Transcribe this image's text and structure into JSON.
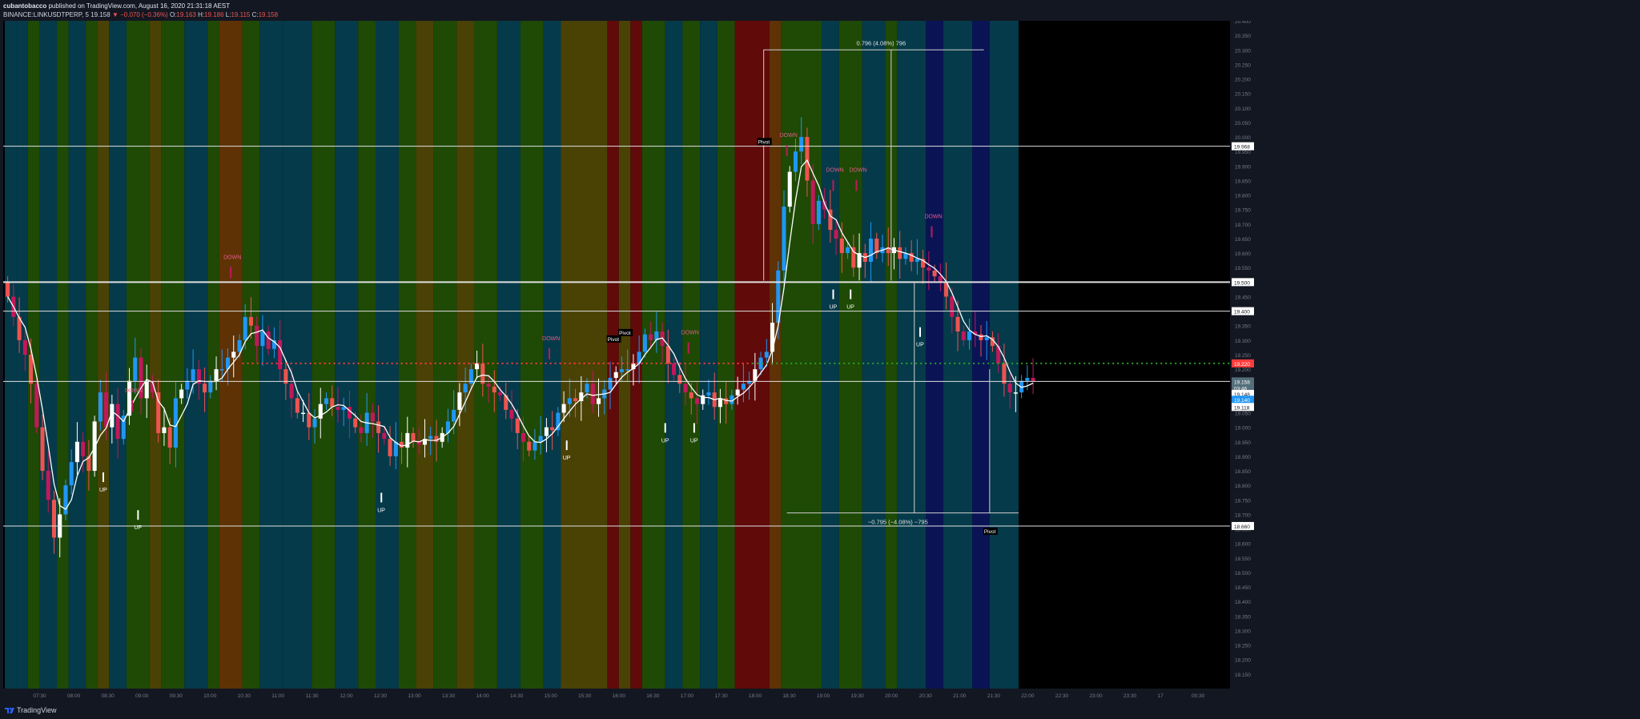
{
  "header": {
    "author": "cubantobacco",
    "published_text": "published on TradingView.com, August 16, 2020 21:31:18 AEST",
    "symbol": "BINANCE:LINKUSDTPERP, 5",
    "last": "19.158",
    "change": "−0.070 (−0.36%)",
    "o_label": "O:",
    "o": "19.163",
    "h_label": "H:",
    "h": "19.186",
    "l_label": "L:",
    "l": "19.115",
    "c_label": "C:",
    "c": "19.158"
  },
  "footer": {
    "brand": "TradingView"
  },
  "colors": {
    "bg": "#131722",
    "plot_bg": "#000000",
    "up_blue": "#2196f3",
    "up_white": "#ffffff",
    "down_red": "#ef5350",
    "down_magenta": "#c2185b",
    "band_blue": "#053a4a",
    "band_green": "#1e4a05",
    "band_olive": "#4a4205",
    "band_brown": "#5e3205",
    "band_red": "#600a0a",
    "band_navy": "#0a1455"
  },
  "chart_data": {
    "type": "candlestick",
    "symbol": "BINANCE:LINKUSDTPERP",
    "interval": "5",
    "ylim": [
      18.1,
      20.4
    ],
    "y_ticks": [
      "20.400",
      "20.350",
      "20.300",
      "20.250",
      "20.200",
      "20.150",
      "20.100",
      "20.050",
      "20.000",
      "19.950",
      "19.900",
      "19.850",
      "19.800",
      "19.750",
      "19.700",
      "19.650",
      "19.600",
      "19.550",
      "19.500",
      "19.450",
      "19.400",
      "19.350",
      "19.300",
      "19.250",
      "19.200",
      "19.150",
      "19.100",
      "19.050",
      "19.000",
      "18.950",
      "18.900",
      "18.850",
      "18.800",
      "18.750",
      "18.700",
      "18.650",
      "18.600",
      "18.550",
      "18.500",
      "18.450",
      "18.400",
      "18.350",
      "18.300",
      "18.250",
      "18.200",
      "18.150"
    ],
    "x_ticks": [
      "07:30",
      "08:00",
      "08:30",
      "09:00",
      "09:30",
      "10:00",
      "10:30",
      "11:00",
      "11:30",
      "12:00",
      "12:30",
      "13:00",
      "13:30",
      "14:00",
      "14:30",
      "15:00",
      "15:30",
      "16:00",
      "16:30",
      "17:00",
      "17:30",
      "18:00",
      "18:30",
      "19:00",
      "19:30",
      "20:00",
      "20:30",
      "21:00",
      "21:30",
      "22:00",
      "22:30",
      "23:00",
      "23:30",
      "17",
      "00:30"
    ],
    "first_bar_time": "07:00",
    "last_bar_time": "21:30",
    "bar_minutes": 5,
    "axis_end_time": "00:30",
    "background_bands": [
      {
        "from": "07:00",
        "to": "07:10",
        "color": "blue"
      },
      {
        "from": "07:10",
        "to": "07:20",
        "color": "blue"
      },
      {
        "from": "07:20",
        "to": "07:30",
        "color": "green"
      },
      {
        "from": "07:30",
        "to": "07:45",
        "color": "blue"
      },
      {
        "from": "07:45",
        "to": "07:55",
        "color": "green"
      },
      {
        "from": "07:55",
        "to": "08:10",
        "color": "blue"
      },
      {
        "from": "08:10",
        "to": "08:20",
        "color": "green"
      },
      {
        "from": "08:20",
        "to": "08:30",
        "color": "olive"
      },
      {
        "from": "08:30",
        "to": "08:45",
        "color": "blue"
      },
      {
        "from": "08:45",
        "to": "09:05",
        "color": "green"
      },
      {
        "from": "09:05",
        "to": "09:15",
        "color": "olive"
      },
      {
        "from": "09:15",
        "to": "09:35",
        "color": "green"
      },
      {
        "from": "09:35",
        "to": "09:55",
        "color": "blue"
      },
      {
        "from": "09:55",
        "to": "10:05",
        "color": "green"
      },
      {
        "from": "10:05",
        "to": "10:25",
        "color": "brown"
      },
      {
        "from": "10:25",
        "to": "10:40",
        "color": "green"
      },
      {
        "from": "10:40",
        "to": "11:00",
        "color": "blue"
      },
      {
        "from": "11:00",
        "to": "11:25",
        "color": "blue"
      },
      {
        "from": "11:25",
        "to": "11:45",
        "color": "green"
      },
      {
        "from": "11:45",
        "to": "12:05",
        "color": "blue"
      },
      {
        "from": "12:05",
        "to": "12:20",
        "color": "green"
      },
      {
        "from": "12:20",
        "to": "12:40",
        "color": "blue"
      },
      {
        "from": "12:40",
        "to": "12:55",
        "color": "green"
      },
      {
        "from": "12:55",
        "to": "13:10",
        "color": "olive"
      },
      {
        "from": "13:10",
        "to": "13:30",
        "color": "green"
      },
      {
        "from": "13:30",
        "to": "13:45",
        "color": "olive"
      },
      {
        "from": "13:45",
        "to": "14:05",
        "color": "green"
      },
      {
        "from": "14:05",
        "to": "14:25",
        "color": "blue"
      },
      {
        "from": "14:25",
        "to": "14:45",
        "color": "green"
      },
      {
        "from": "14:45",
        "to": "15:00",
        "color": "blue"
      },
      {
        "from": "15:00",
        "to": "15:10",
        "color": "olive"
      },
      {
        "from": "15:10",
        "to": "15:40",
        "color": "olive"
      },
      {
        "from": "15:40",
        "to": "15:50",
        "color": "red"
      },
      {
        "from": "15:50",
        "to": "16:00",
        "color": "olive"
      },
      {
        "from": "16:00",
        "to": "16:10",
        "color": "red"
      },
      {
        "from": "16:10",
        "to": "16:30",
        "color": "green"
      },
      {
        "from": "16:30",
        "to": "16:45",
        "color": "blue"
      },
      {
        "from": "16:45",
        "to": "17:00",
        "color": "green"
      },
      {
        "from": "17:00",
        "to": "17:15",
        "color": "blue"
      },
      {
        "from": "17:15",
        "to": "17:30",
        "color": "green"
      },
      {
        "from": "17:30",
        "to": "18:00",
        "color": "red"
      },
      {
        "from": "18:00",
        "to": "18:10",
        "color": "brown"
      },
      {
        "from": "18:10",
        "to": "18:45",
        "color": "green"
      },
      {
        "from": "18:45",
        "to": "19:00",
        "color": "blue"
      },
      {
        "from": "19:00",
        "to": "19:20",
        "color": "green"
      },
      {
        "from": "19:20",
        "to": "19:40",
        "color": "blue"
      },
      {
        "from": "19:40",
        "to": "19:50",
        "color": "green"
      },
      {
        "from": "19:50",
        "to": "20:15",
        "color": "blue"
      },
      {
        "from": "20:15",
        "to": "20:30",
        "color": "navy"
      },
      {
        "from": "20:30",
        "to": "20:55",
        "color": "blue"
      },
      {
        "from": "20:55",
        "to": "21:10",
        "color": "navy"
      },
      {
        "from": "21:10",
        "to": "21:35",
        "color": "blue"
      }
    ],
    "closes": [
      19.45,
      19.38,
      19.3,
      19.25,
      19.15,
      19.0,
      18.85,
      18.75,
      18.62,
      18.7,
      18.8,
      18.88,
      18.95,
      18.9,
      18.85,
      19.02,
      19.12,
      19.0,
      19.08,
      18.96,
      19.04,
      19.16,
      19.24,
      19.1,
      19.16,
      19.12,
      18.98,
      19.0,
      18.93,
      19.1,
      19.13,
      19.16,
      19.2,
      19.15,
      19.12,
      19.16,
      19.2,
      19.2,
      19.24,
      19.26,
      19.3,
      19.38,
      19.35,
      19.28,
      19.33,
      19.27,
      19.3,
      19.2,
      19.15,
      19.1,
      19.05,
      19.05,
      19.0,
      19.03,
      19.08,
      19.1,
      19.07,
      19.06,
      19.07,
      19.03,
      19.0,
      18.98,
      19.05,
      19.02,
      18.98,
      18.96,
      18.9,
      18.95,
      18.93,
      18.98,
      18.95,
      18.94,
      18.96,
      18.97,
      18.95,
      18.98,
      19.02,
      19.06,
      19.12,
      19.15,
      19.2,
      19.22,
      19.15,
      19.14,
      19.12,
      19.11,
      19.06,
      19.03,
      18.98,
      18.95,
      18.92,
      18.95,
      18.97,
      19.0,
      18.99,
      19.05,
      19.08,
      19.1,
      19.09,
      19.12,
      19.15,
      19.08,
      19.1,
      19.13,
      19.17,
      19.19,
      19.2,
      19.2,
      19.22,
      19.26,
      19.32,
      19.3,
      19.33,
      19.28,
      19.22,
      19.18,
      19.15,
      19.12,
      19.1,
      19.08,
      19.11,
      19.12,
      19.07,
      19.1,
      19.08,
      19.11,
      19.13,
      19.15,
      19.16,
      19.2,
      19.24,
      19.26,
      19.36,
      19.54,
      19.76,
      19.88,
      19.95,
      20.0,
      19.85,
      19.7,
      19.78,
      19.75,
      19.68,
      19.65,
      19.6,
      19.62,
      19.55,
      19.6,
      19.57,
      19.65,
      19.6,
      19.62,
      19.6,
      19.62,
      19.58,
      19.6,
      19.57,
      19.58,
      19.55,
      19.54,
      19.52,
      19.5,
      19.45,
      19.38,
      19.33,
      19.3,
      19.33,
      19.32,
      19.3,
      19.31,
      19.28,
      19.22,
      19.15,
      19.12,
      19.12,
      19.16,
      19.17,
      19.158
    ],
    "horizontal_levels": [
      {
        "price": 19.968,
        "label": "19.968"
      },
      {
        "price": 19.5,
        "label": "19.500"
      },
      {
        "price": 19.4,
        "label": "19.400"
      },
      {
        "price": 19.158,
        "label": "19.158"
      },
      {
        "price": 18.66,
        "label": "18.660"
      }
    ],
    "dotted_levels": [
      {
        "price": 19.22,
        "label": "19.220",
        "color": "red"
      },
      {
        "price": 19.22,
        "color": "green"
      }
    ],
    "price_labels_right": [
      "19.968",
      "19.500",
      "19.400",
      "19.220",
      "19.158",
      "03:46",
      "19.148",
      "19.140",
      "19.118",
      "18.660"
    ],
    "range_annotations": [
      {
        "text": "0.796 (4.08%) 796"
      },
      {
        "text": "−0.795 (−4.08%) −795"
      }
    ],
    "markers": [
      {
        "text": "UP",
        "time": "08:25",
        "kind": "up"
      },
      {
        "text": "UP",
        "time": "08:55",
        "kind": "up"
      },
      {
        "text": "UP",
        "time": "12:25",
        "kind": "up"
      },
      {
        "text": "UP",
        "time": "15:05",
        "kind": "up"
      },
      {
        "text": "UP",
        "time": "16:30",
        "kind": "up"
      },
      {
        "text": "UP",
        "time": "16:55",
        "kind": "up"
      },
      {
        "text": "UP",
        "time": "18:55",
        "kind": "up"
      },
      {
        "text": "UP",
        "time": "19:10",
        "kind": "up"
      },
      {
        "text": "UP",
        "time": "20:10",
        "kind": "up"
      },
      {
        "text": "DOWN",
        "time": "08:50",
        "kind": "down"
      },
      {
        "text": "DOWN",
        "time": "10:15",
        "kind": "down"
      },
      {
        "text": "DOWN",
        "time": "14:50",
        "kind": "down"
      },
      {
        "text": "DOWN",
        "time": "16:50",
        "kind": "down"
      },
      {
        "text": "DOWN",
        "time": "18:15",
        "kind": "down"
      },
      {
        "text": "DOWN",
        "time": "18:55",
        "kind": "down"
      },
      {
        "text": "DOWN",
        "time": "19:15",
        "kind": "down"
      },
      {
        "text": "DOWN",
        "time": "20:20",
        "kind": "down"
      }
    ],
    "pivots": [
      {
        "text": "Pivot",
        "time": "15:45"
      },
      {
        "text": "Pivot",
        "time": "15:55"
      },
      {
        "text": "Pivot",
        "time": "17:55"
      },
      {
        "text": "Pivot",
        "time": "21:10"
      }
    ]
  }
}
